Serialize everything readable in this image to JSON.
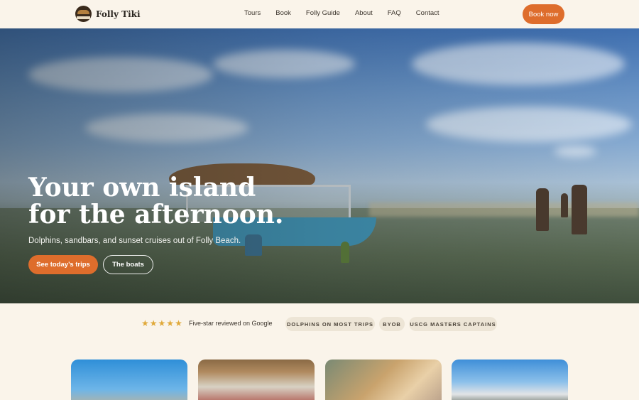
{
  "brand": {
    "name": "Folly Tiki"
  },
  "nav": {
    "items": [
      {
        "label": "Tours"
      },
      {
        "label": "Book"
      },
      {
        "label": "Folly Guide"
      },
      {
        "label": "About"
      },
      {
        "label": "FAQ"
      },
      {
        "label": "Contact"
      }
    ],
    "cta_label": "Book now"
  },
  "hero": {
    "title_line1": "Your own island",
    "title_line2": "for the afternoon.",
    "subtitle": "Dolphins, sandbars, and sunset cruises out of Folly Beach.",
    "primary_button": "See today’s trips",
    "secondary_button": "The boats"
  },
  "trust": {
    "stars": 5,
    "rating_text": "Five-star reviewed on Google",
    "badges": [
      "DOLPHINS ON MOST TRIPS",
      "BYOB",
      "USCG MASTERS CAPTAINS"
    ]
  },
  "colors": {
    "accent": "#de6d2c",
    "background": "#faf4ea",
    "star": "#e0a93a"
  }
}
